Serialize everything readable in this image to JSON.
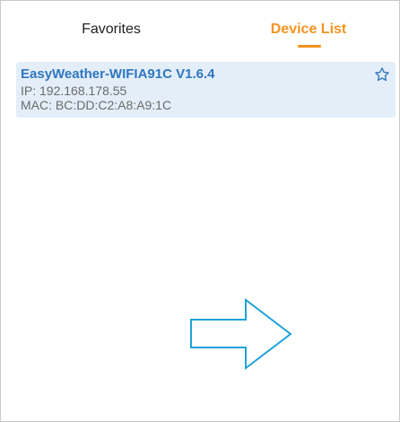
{
  "tabs": {
    "favorites_label": "Favorites",
    "device_list_label": "Device List",
    "active": "device_list"
  },
  "devices": [
    {
      "name": "EasyWeather-WIFIA91C V1.6.4",
      "ip": "IP: 192.168.178.55",
      "mac": "MAC: BC:DD:C2:A8:A9:1C",
      "icon": "star-outline-icon"
    }
  ],
  "colors": {
    "active_tab": "#f5931f",
    "device_name": "#2f76c1",
    "card_background": "#e3eef8",
    "arrow_outline": "#1ea3d9"
  }
}
